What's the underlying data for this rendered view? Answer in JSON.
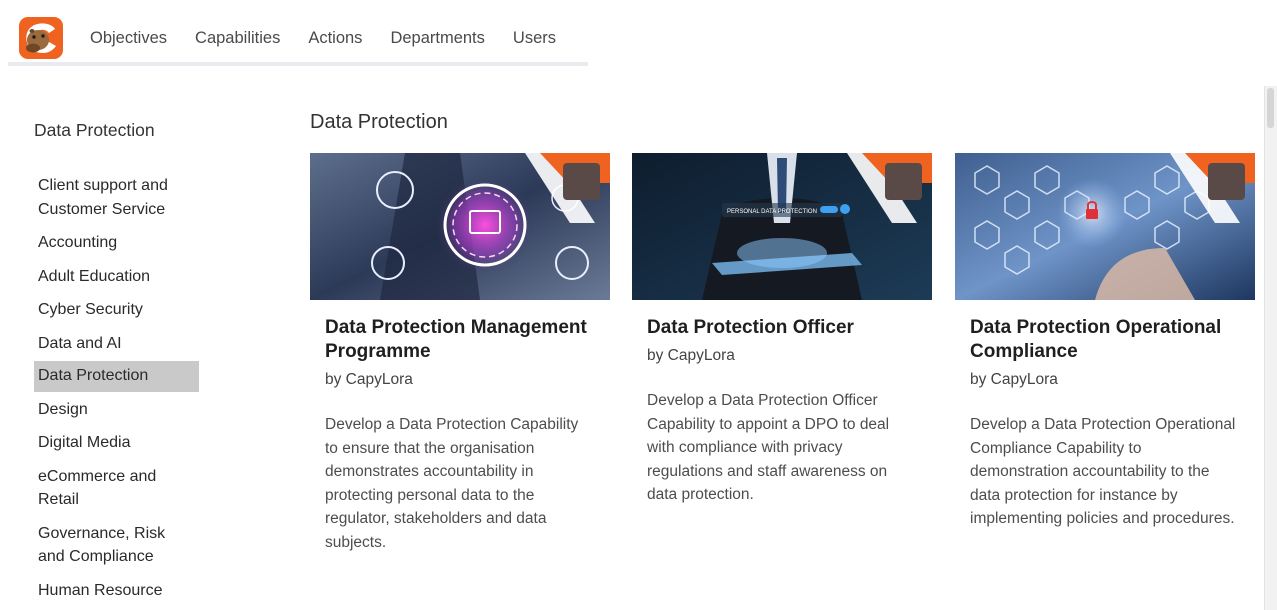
{
  "nav": {
    "logo_alt": "CapyLora logo",
    "items": [
      "Objectives",
      "Capabilities",
      "Actions",
      "Departments",
      "Users"
    ]
  },
  "sidebar": {
    "title": "Data Protection",
    "items": [
      {
        "label": "Client support and Customer Service",
        "active": false
      },
      {
        "label": "Accounting",
        "active": false
      },
      {
        "label": "Adult Education",
        "active": false
      },
      {
        "label": "Cyber Security",
        "active": false
      },
      {
        "label": "Data and AI",
        "active": false
      },
      {
        "label": "Data Protection",
        "active": true
      },
      {
        "label": "Design",
        "active": false
      },
      {
        "label": "Digital Media",
        "active": false
      },
      {
        "label": "eCommerce and Retail",
        "active": false
      },
      {
        "label": "Governance, Risk and Compliance",
        "active": false
      },
      {
        "label": "Human Resource",
        "active": false
      }
    ]
  },
  "main": {
    "title": "Data Protection",
    "cards": [
      {
        "title": "Data Protection Management Programme",
        "author": "by CapyLora",
        "description": "Develop a Data Protection Capability to ensure that the organisation demonstrates accountability in protecting personal data to the regulator, stakeholders and data subjects."
      },
      {
        "title": "Data Protection Officer",
        "author": "by CapyLora",
        "description": "Develop a Data Protection Officer Capability to appoint a DPO to deal with compliance with privacy regulations and staff awareness on data protection.",
        "image_text": "PERSONAL DATA PROTECTION"
      },
      {
        "title": "Data Protection Operational Compliance",
        "author": "by CapyLora",
        "description": "Develop a Data Protection Operational Compliance Capability to demonstration accountability to the data protection for instance by implementing policies and procedures."
      }
    ]
  },
  "colors": {
    "brand_orange": "#f0621f",
    "badge": "#5a4a47",
    "active_bg": "#c9c9c9"
  }
}
